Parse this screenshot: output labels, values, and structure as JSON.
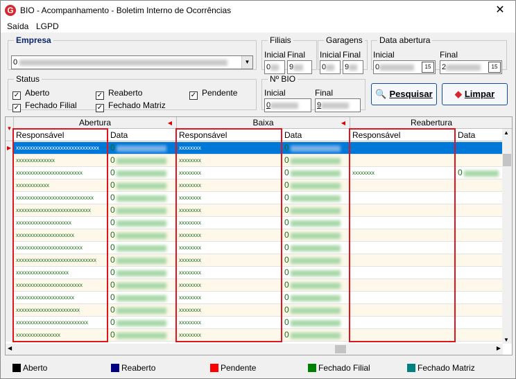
{
  "window": {
    "title": "BIO - Acompanhamento - Boletim Interno de Ocorrências",
    "close_glyph": "✕",
    "icon_letter": "G"
  },
  "menu": [
    "Saída",
    "LGPD"
  ],
  "empresa": {
    "legend": "Empresa",
    "value_prefix": "0"
  },
  "filiais": {
    "legend": "Filiais",
    "inicial_label": "Inicial",
    "final_label": "Final",
    "inicial_value": "0",
    "final_value": "9"
  },
  "garagens": {
    "legend": "Garagens",
    "inicial_label": "Inicial",
    "final_label": "Final",
    "inicial_value": "0",
    "final_value": "9"
  },
  "data_abertura": {
    "legend": "Data abertura",
    "inicial_label": "Inicial",
    "final_label": "Final",
    "inicial_value": "0",
    "final_value": "2",
    "cal_label": "15"
  },
  "status": {
    "legend": "Status",
    "items": [
      {
        "label": "Aberto",
        "checked": true
      },
      {
        "label": "Reaberto",
        "checked": true
      },
      {
        "label": "Pendente",
        "checked": true
      },
      {
        "label": "Fechado Filial",
        "checked": true
      },
      {
        "label": "Fechado Matriz",
        "checked": true
      }
    ]
  },
  "nbio": {
    "legend": "Nº BIO",
    "inicial_label": "Inicial",
    "final_label": "Final",
    "inicial_value": "0",
    "final_value": "9"
  },
  "buttons": {
    "pesquisar": "Pesquisar",
    "limpar": "Limpar"
  },
  "grid": {
    "groups": [
      "Abertura",
      "Baixa",
      "Reabertura"
    ],
    "col_responsavel": "Responsável",
    "col_data": "Data",
    "rows": [
      {
        "ab_resp": "xxxxxxxxxxxxxxxxxxxxxxxxxxxxxx",
        "bx_resp": "xxxxxxxx",
        "re_resp": "",
        "selected": true
      },
      {
        "ab_resp": "xxxxxxxxxxxxxx",
        "bx_resp": "xxxxxxxx",
        "re_resp": ""
      },
      {
        "ab_resp": "xxxxxxxxxxxxxxxxxxxxxxxx",
        "bx_resp": "xxxxxxxx",
        "re_resp": "xxxxxxxx"
      },
      {
        "ab_resp": "xxxxxxxxxxxx",
        "bx_resp": "xxxxxxxx",
        "re_resp": ""
      },
      {
        "ab_resp": "xxxxxxxxxxxxxxxxxxxxxxxxxxxx",
        "bx_resp": "xxxxxxxx",
        "re_resp": ""
      },
      {
        "ab_resp": "xxxxxxxxxxxxxxxxxxxxxxxxxxx",
        "bx_resp": "xxxxxxxx",
        "re_resp": ""
      },
      {
        "ab_resp": "xxxxxxxxxxxxxxxxxxxx",
        "bx_resp": "xxxxxxxx",
        "re_resp": ""
      },
      {
        "ab_resp": "xxxxxxxxxxxxxxxxxxxxx",
        "bx_resp": "xxxxxxxx",
        "re_resp": ""
      },
      {
        "ab_resp": "xxxxxxxxxxxxxxxxxxxxxxxx",
        "bx_resp": "xxxxxxxx",
        "re_resp": ""
      },
      {
        "ab_resp": "xxxxxxxxxxxxxxxxxxxxxxxxxxxxx",
        "bx_resp": "xxxxxxxx",
        "re_resp": ""
      },
      {
        "ab_resp": "xxxxxxxxxxxxxxxxxxx",
        "bx_resp": "xxxxxxxx",
        "re_resp": ""
      },
      {
        "ab_resp": "xxxxxxxxxxxxxxxxxxxxxxxx",
        "bx_resp": "xxxxxxxx",
        "re_resp": ""
      },
      {
        "ab_resp": "xxxxxxxxxxxxxxxxxxxxx",
        "bx_resp": "xxxxxxxx",
        "re_resp": ""
      },
      {
        "ab_resp": "xxxxxxxxxxxxxxxxxxxxxxx",
        "bx_resp": "xxxxxxxx",
        "re_resp": ""
      },
      {
        "ab_resp": "xxxxxxxxxxxxxxxxxxxxxxxxxx",
        "bx_resp": "xxxxxxxx",
        "re_resp": ""
      },
      {
        "ab_resp": "xxxxxxxxxxxxxxxx",
        "bx_resp": "xxxxxxxx",
        "re_resp": ""
      }
    ],
    "data_zero": "0"
  },
  "legend": [
    {
      "label": "Aberto",
      "color": "#000000"
    },
    {
      "label": "Reaberto",
      "color": "#000080"
    },
    {
      "label": "Pendente",
      "color": "#ff0000"
    },
    {
      "label": "Fechado Filial",
      "color": "#008000"
    },
    {
      "label": "Fechado Matriz",
      "color": "#008080"
    }
  ]
}
